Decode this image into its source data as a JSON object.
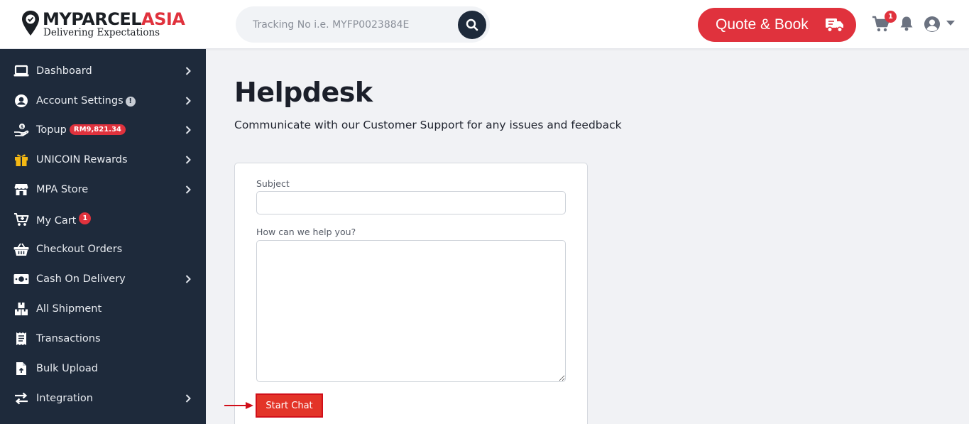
{
  "brand": {
    "name_part1": "MYPARCEL",
    "name_part2": "ASIA",
    "tagline": "Delivering Expectations",
    "accent_color": "#e0323d",
    "sidebar_color": "#1e2a3b"
  },
  "header": {
    "search_placeholder": "Tracking No i.e. MYFP0023884E",
    "search_value": "",
    "quote_label": "Quote & Book",
    "cart_count": "1"
  },
  "sidebar": {
    "items": [
      {
        "label": "Dashboard",
        "icon": "laptop-icon"
      },
      {
        "label": "Account Settings",
        "icon": "user-circle-icon",
        "badge": "!"
      },
      {
        "label": "Topup",
        "icon": "hand-coin-icon",
        "badge": "RM9,821.34"
      },
      {
        "label": "UNICOIN Rewards",
        "icon": "gift-icon"
      },
      {
        "label": "MPA Store",
        "icon": "store-icon"
      },
      {
        "label": "My Cart",
        "icon": "cart-plus-icon",
        "badge": "1"
      },
      {
        "label": "Checkout Orders",
        "icon": "basket-icon"
      },
      {
        "label": "Cash On Delivery",
        "icon": "money-bill-icon"
      },
      {
        "label": "All Shipment",
        "icon": "boxes-icon"
      },
      {
        "label": "Transactions",
        "icon": "receipt-icon"
      },
      {
        "label": "Bulk Upload",
        "icon": "file-upload-icon"
      },
      {
        "label": "Integration",
        "icon": "exchange-icon"
      }
    ]
  },
  "main": {
    "title": "Helpdesk",
    "subtitle": "Communicate with our Customer Support for any issues and feedback",
    "form": {
      "subject_label": "Subject",
      "subject_value": "",
      "message_label": "How can we help you?",
      "message_value": "",
      "submit_label": "Start Chat"
    }
  }
}
